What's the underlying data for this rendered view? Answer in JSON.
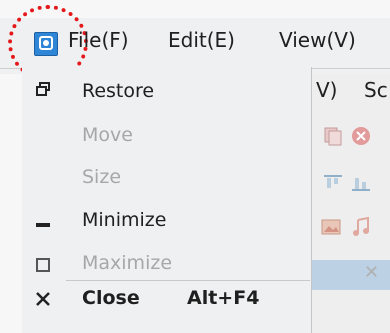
{
  "menubar": {
    "file": "File(F)",
    "edit": "Edit(E)",
    "view": "View(V)"
  },
  "background_window": {
    "label_v": "V)",
    "label_sc": "Sc"
  },
  "system_menu": {
    "items": [
      {
        "label": "Restore",
        "enabled": true,
        "icon": "restore-window-icon"
      },
      {
        "label": "Move",
        "enabled": false,
        "icon": ""
      },
      {
        "label": "Size",
        "enabled": false,
        "icon": ""
      },
      {
        "label": "Minimize",
        "enabled": true,
        "icon": "minimize-icon"
      },
      {
        "label": "Maximize",
        "enabled": false,
        "icon": "maximize-icon"
      },
      {
        "label": "Close",
        "enabled": true,
        "icon": "close-icon",
        "shortcut": "Alt+F4"
      }
    ]
  },
  "colors": {
    "highlight": "#e5191b",
    "app_icon": "#2f86d6"
  }
}
